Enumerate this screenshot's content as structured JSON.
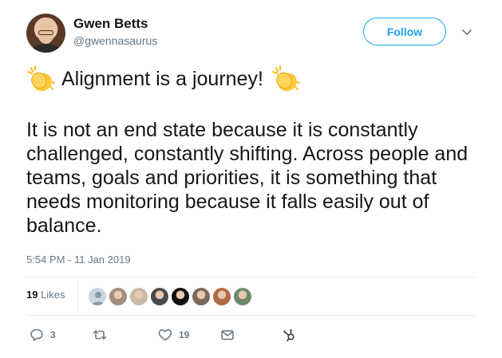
{
  "user": {
    "display_name": "Gwen Betts",
    "handle": "@gwennasaurus"
  },
  "follow_label": "Follow",
  "tweet": {
    "headline": "Alignment is a journey!",
    "body": "It is not an end state because it is constantly challenged, constantly shifting. Across people and teams, goals and priorities, it is something that needs monitoring because it falls easily out of balance.",
    "timestamp": "5:54 PM - 11 Jan 2019"
  },
  "likes": {
    "count": "19",
    "label": "Likes"
  },
  "liker_avatars": [
    {
      "icon": "default-avatar-icon",
      "color": "#8899a6"
    },
    {
      "icon": "liker-avatar",
      "color": "#a08d7c"
    },
    {
      "icon": "liker-avatar",
      "color": "#c9b9a8"
    },
    {
      "icon": "liker-avatar",
      "color": "#4a4a4a"
    },
    {
      "icon": "liker-avatar",
      "color": "#111111"
    },
    {
      "icon": "liker-avatar",
      "color": "#7d6a5a"
    },
    {
      "icon": "liker-avatar",
      "color": "#b06b45"
    },
    {
      "icon": "liker-avatar",
      "color": "#6f8a6a"
    }
  ],
  "actions": {
    "reply_count": "3",
    "retweet_count": "",
    "like_count": "19",
    "icons": [
      "reply-icon",
      "retweet-icon",
      "heart-icon",
      "direct-message-icon",
      "hubspot-icon"
    ]
  },
  "colors": {
    "accent": "#1da1f2",
    "muted": "#657786",
    "text": "#14171a",
    "clap": "#ffc83d"
  }
}
